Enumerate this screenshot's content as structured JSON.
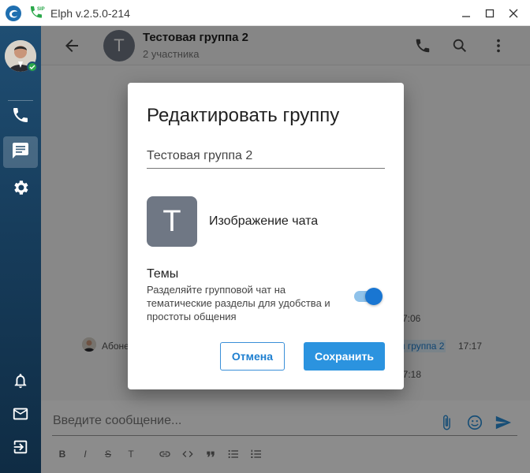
{
  "window": {
    "title": "Elph v.2.5.0-214",
    "sip_label": "SIP"
  },
  "chat": {
    "title": "Тестовая группа 2",
    "subtitle": "2 участника",
    "avatar_letter": "T"
  },
  "messages": [
    {
      "sender": "Абоне",
      "time": "7:06"
    },
    {
      "sender": "Абоне",
      "group_tag": "я группа 2",
      "time": "17:17"
    },
    {
      "time": "17:18"
    }
  ],
  "composer": {
    "placeholder": "Введите сообщение...",
    "formatting": [
      "B",
      "I",
      "S",
      "T",
      "link",
      "code",
      "quote",
      "bullet-list",
      "numbered-list"
    ]
  },
  "modal": {
    "title": "Редактировать группу",
    "name_value": "Тестовая группа 2",
    "image_letter": "T",
    "image_label": "Изображение чата",
    "topics_title": "Темы",
    "topics_desc": "Разделяйте групповой чат на тематические разделы для удобства и простоты общения",
    "topics_enabled": true,
    "cancel_label": "Отмена",
    "save_label": "Сохранить"
  },
  "colors": {
    "accent": "#2b93df",
    "sidebar": "#1f4e73",
    "online": "#2aa84a",
    "avatar_bg": "#6f7784"
  }
}
